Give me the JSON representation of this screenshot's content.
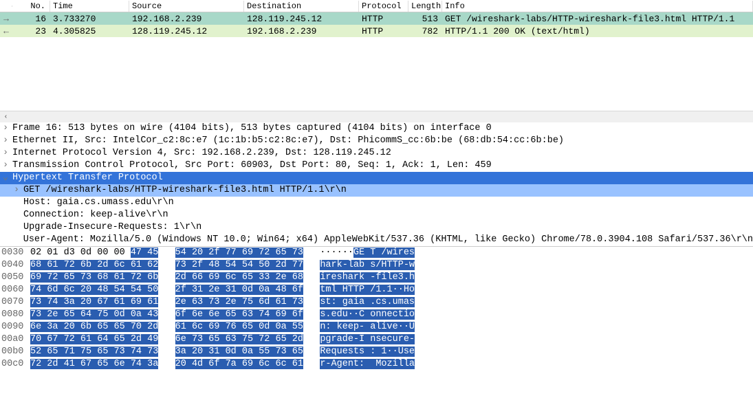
{
  "packet_list": {
    "columns": [
      "No.",
      "Time",
      "Source",
      "Destination",
      "Protocol",
      "Length",
      "Info"
    ],
    "rows": [
      {
        "dir": "out",
        "no": "16",
        "time": "3.733270",
        "source": "192.168.2.239",
        "dest": "128.119.245.12",
        "proto": "HTTP",
        "len": "513",
        "info": "GET /wireshark-labs/HTTP-wireshark-file3.html HTTP/1.1"
      },
      {
        "dir": "in",
        "no": "23",
        "time": "4.305825",
        "source": "128.119.245.12",
        "dest": "192.168.2.239",
        "proto": "HTTP",
        "len": "782",
        "info": "HTTP/1.1 200 OK  (text/html)"
      }
    ]
  },
  "details": {
    "frame": "Frame 16: 513 bytes on wire (4104 bits), 513 bytes captured (4104 bits) on interface 0",
    "eth": "Ethernet II, Src: IntelCor_c2:8c:e7 (1c:1b:b5:c2:8c:e7), Dst: PhicommS_cc:6b:be (68:db:54:cc:6b:be)",
    "ip": "Internet Protocol Version 4, Src: 192.168.2.239, Dst: 128.119.245.12",
    "tcp": "Transmission Control Protocol, Src Port: 60903, Dst Port: 80, Seq: 1, Ack: 1, Len: 459",
    "http": "Hypertext Transfer Protocol",
    "get": "GET /wireshark-labs/HTTP-wireshark-file3.html HTTP/1.1\\r\\n",
    "host": "Host: gaia.cs.umass.edu\\r\\n",
    "conn": "Connection: keep-alive\\r\\n",
    "upgrade": "Upgrade-Insecure-Requests: 1\\r\\n",
    "ua": "User-Agent: Mozilla/5.0 (Windows NT 10.0; Win64; x64) AppleWebKit/537.36 (KHTML, like Gecko) Chrome/78.0.3904.108 Safari/537.36\\r\\n"
  },
  "hex": {
    "rows": [
      {
        "off": "0030",
        "pre": "02 01 d3 0d 00 00 ",
        "sel1": "47 45",
        "mid": "   ",
        "sel2": "54 20 2f 77 69 72 65 73",
        "ascii_pre": "   ······",
        "ascii_sel": "GE T /wires"
      },
      {
        "off": "0040",
        "pre": "",
        "sel1": "68 61 72 6b 2d 6c 61 62",
        "mid": "   ",
        "sel2": "73 2f 48 54 54 50 2d 77",
        "ascii_pre": "   ",
        "ascii_sel": "hark-lab s/HTTP-w"
      },
      {
        "off": "0050",
        "pre": "",
        "sel1": "69 72 65 73 68 61 72 6b",
        "mid": "   ",
        "sel2": "2d 66 69 6c 65 33 2e 68",
        "ascii_pre": "   ",
        "ascii_sel": "ireshark -file3.h"
      },
      {
        "off": "0060",
        "pre": "",
        "sel1": "74 6d 6c 20 48 54 54 50",
        "mid": "   ",
        "sel2": "2f 31 2e 31 0d 0a 48 6f",
        "ascii_pre": "   ",
        "ascii_sel": "tml HTTP /1.1··Ho"
      },
      {
        "off": "0070",
        "pre": "",
        "sel1": "73 74 3a 20 67 61 69 61",
        "mid": "   ",
        "sel2": "2e 63 73 2e 75 6d 61 73",
        "ascii_pre": "   ",
        "ascii_sel": "st: gaia .cs.umas"
      },
      {
        "off": "0080",
        "pre": "",
        "sel1": "73 2e 65 64 75 0d 0a 43",
        "mid": "   ",
        "sel2": "6f 6e 6e 65 63 74 69 6f",
        "ascii_pre": "   ",
        "ascii_sel": "s.edu··C onnectio"
      },
      {
        "off": "0090",
        "pre": "",
        "sel1": "6e 3a 20 6b 65 65 70 2d",
        "mid": "   ",
        "sel2": "61 6c 69 76 65 0d 0a 55",
        "ascii_pre": "   ",
        "ascii_sel": "n: keep- alive··U"
      },
      {
        "off": "00a0",
        "pre": "",
        "sel1": "70 67 72 61 64 65 2d 49",
        "mid": "   ",
        "sel2": "6e 73 65 63 75 72 65 2d",
        "ascii_pre": "   ",
        "ascii_sel": "pgrade-I nsecure-"
      },
      {
        "off": "00b0",
        "pre": "",
        "sel1": "52 65 71 75 65 73 74 73",
        "mid": "   ",
        "sel2": "3a 20 31 0d 0a 55 73 65",
        "ascii_pre": "   ",
        "ascii_sel": "Requests : 1··Use"
      },
      {
        "off": "00c0",
        "pre": "",
        "sel1": "72 2d 41 67 65 6e 74 3a",
        "mid": "   ",
        "sel2": "20 4d 6f 7a 69 6c 6c 61",
        "ascii_pre": "   ",
        "ascii_sel": "r-Agent:  Mozilla"
      }
    ]
  }
}
